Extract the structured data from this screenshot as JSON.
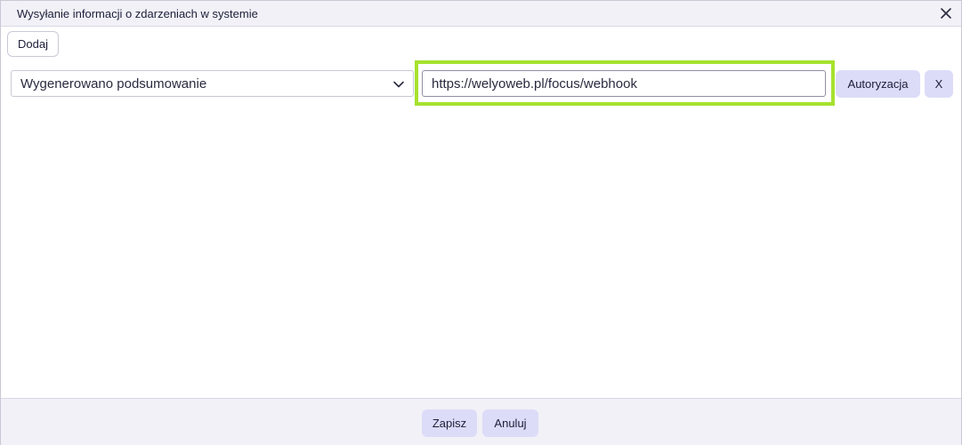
{
  "dialog": {
    "title": "Wysyłanie informacji o zdarzeniach w systemie"
  },
  "toolbar": {
    "add_label": "Dodaj"
  },
  "row": {
    "event_select_value": "Wygenerowano podsumowanie",
    "url_value": "https://welyoweb.pl/focus/webhook",
    "auth_label": "Autoryzacja",
    "remove_label": "X"
  },
  "footer": {
    "save_label": "Zapisz",
    "cancel_label": "Anuluj"
  },
  "colors": {
    "highlight": "#a6e22e",
    "soft_button": "#dcdcf8",
    "panel": "#f1f1f7"
  },
  "icons": {
    "close": "close-icon",
    "select": "chevron-down-icon"
  }
}
